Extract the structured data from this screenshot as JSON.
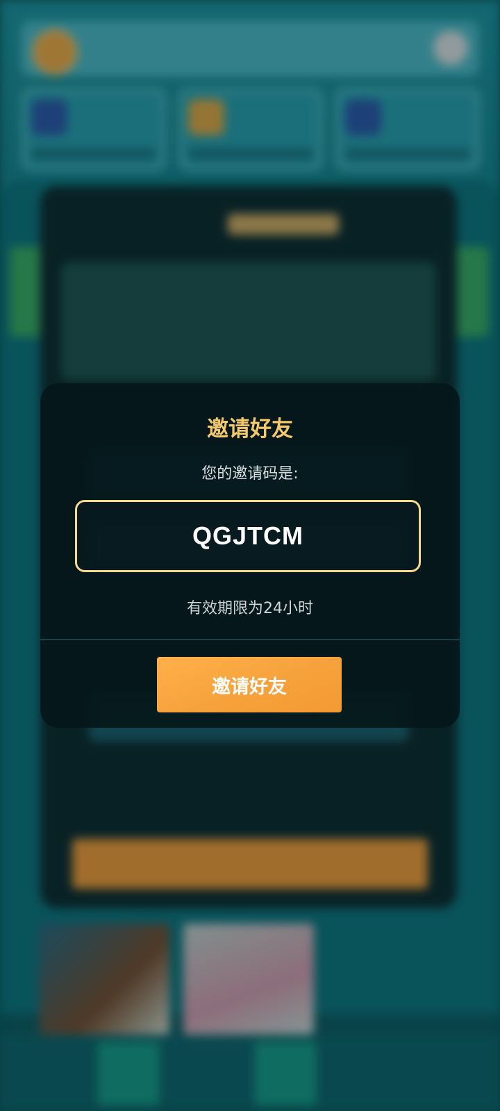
{
  "dialog": {
    "title": "邀请好友",
    "code_label": "您的邀请码是:",
    "invite_code": "QGJTCM",
    "validity": "有效期限为24小时",
    "invite_button": "邀请好友"
  },
  "colors": {
    "title": "#f5c96a",
    "code_border": "#f5d98d",
    "button": "#f6a23c",
    "dialog_bg": "#06161a"
  }
}
